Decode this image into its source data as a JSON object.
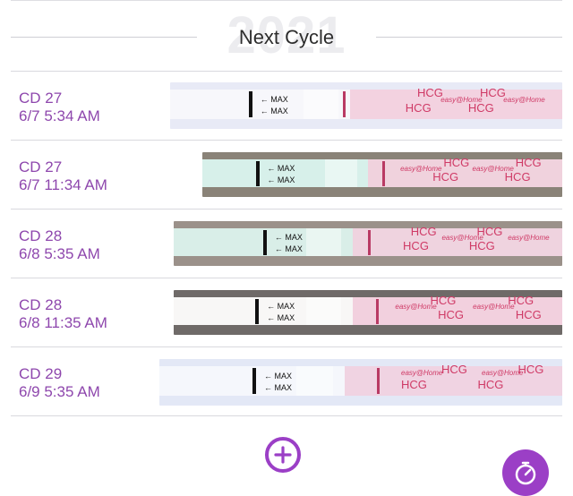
{
  "section": {
    "year": "2021",
    "title": "Next Cycle"
  },
  "entries": [
    {
      "cycle_day": "CD 27",
      "datetime": "6/7 5:34 AM"
    },
    {
      "cycle_day": "CD 27",
      "datetime": "6/7 11:34 AM"
    },
    {
      "cycle_day": "CD 28",
      "datetime": "6/8 5:35 AM"
    },
    {
      "cycle_day": "CD 28",
      "datetime": "6/8 11:35 AM"
    },
    {
      "cycle_day": "CD 29",
      "datetime": "6/9 5:35 AM"
    }
  ],
  "strip_text": {
    "max": "← MAX",
    "hcg": "HCG",
    "brand": "easy@Home"
  },
  "icons": {
    "add": "plus-circle-icon",
    "timer": "stopwatch-icon"
  },
  "colors": {
    "accent": "#9b3fc6",
    "label": "#8e47ad",
    "test_line": "#b93a64"
  }
}
